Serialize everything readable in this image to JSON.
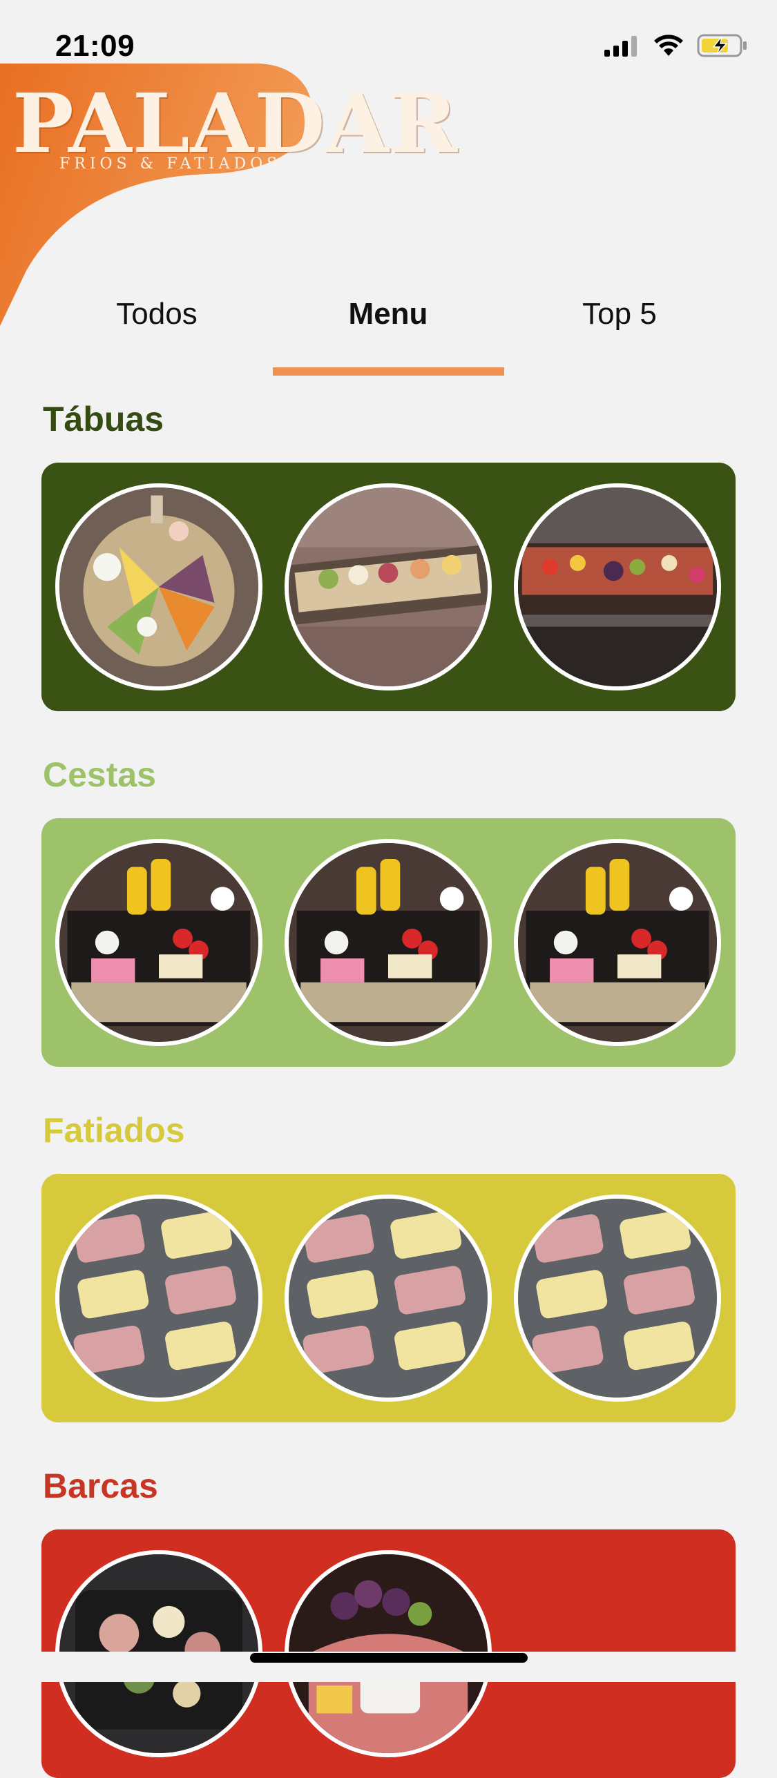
{
  "status_bar": {
    "time": "21:09",
    "icons": [
      "cellular-signal-icon",
      "wifi-icon",
      "battery-charging-icon"
    ]
  },
  "brand": {
    "name": "PALADAR",
    "tagline": "FRIOS & FATIADOS",
    "accent_color": "#f07a2e"
  },
  "tabs": [
    {
      "label": "Todos",
      "active": false
    },
    {
      "label": "Menu",
      "active": true
    },
    {
      "label": "Top 5",
      "active": false
    }
  ],
  "tab_indicator_color": "#ef9250",
  "sections": [
    {
      "title": "Tábuas",
      "title_color": "#344c12",
      "card_color": "#3a5314",
      "image_count": 3
    },
    {
      "title": "Cestas",
      "title_color": "#9dc26a",
      "card_color": "#9dc26a",
      "image_count": 3
    },
    {
      "title": "Fatiados",
      "title_color": "#d6c93c",
      "card_color": "#d6c93c",
      "image_count": 3
    },
    {
      "title": "Barcas",
      "title_color": "#c73524",
      "card_color": "#d12e22",
      "image_count": 2
    }
  ]
}
